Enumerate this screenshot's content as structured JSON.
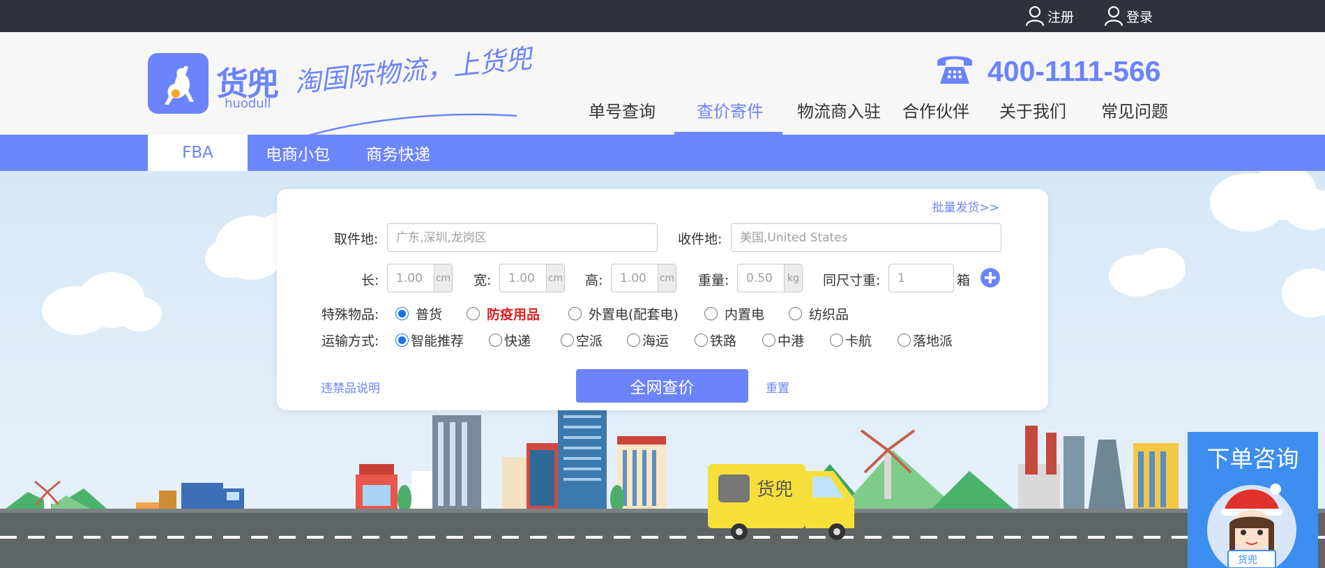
{
  "top_bar": {
    "register": "注册",
    "login": "登录"
  },
  "header": {
    "logo_text": "货兜",
    "logo_sub": "huodull",
    "slogan": "淘国际物流，上货兜",
    "phone": "400-1111-566",
    "nav": [
      "单号查询",
      "查价寄件",
      "物流商入驻",
      "合作伙伴",
      "关于我们",
      "常见问题"
    ],
    "active_nav": "查价寄件"
  },
  "sub_tabs": [
    "FBA",
    "电商小包",
    "商务快递"
  ],
  "form": {
    "batch_link": "批量发货>>",
    "pickup_label": "取件地:",
    "pickup_placeholder": "广东,深圳,龙岗区",
    "delivery_label": "收件地:",
    "delivery_placeholder": "美国,United States",
    "length_label": "长:",
    "length_placeholder": "1.00",
    "width_label": "宽:",
    "width_placeholder": "1.00",
    "height_label": "高:",
    "height_placeholder": "1.00",
    "dim_unit": "cm",
    "weight_label": "重量:",
    "weight_placeholder": "0.50",
    "weight_unit": "kg",
    "same_size_label": "同尺寸重:",
    "same_size_placeholder": "1",
    "box_unit": "箱",
    "special_label": "特殊物品:",
    "special_options": [
      "普货",
      "防疫用品",
      "外置电(配套电)",
      "内置电",
      "纺织品"
    ],
    "special_selected": "普货",
    "transport_label": "运输方式:",
    "transport_options": [
      "智能推荐",
      "快递",
      "空派",
      "海运",
      "铁路",
      "中港",
      "卡航",
      "落地派"
    ],
    "transport_selected": "智能推荐",
    "prohibited_link": "违禁品说明",
    "search_button": "全网查价",
    "reset_link": "重置"
  },
  "consult": {
    "title": "下单咨询",
    "avatar_logo": "货兜"
  },
  "colors": {
    "brand": "#6b83fb",
    "topbar": "#2f323b",
    "radio_checked": "#1a73e8",
    "highlight_red": "#e02020"
  }
}
